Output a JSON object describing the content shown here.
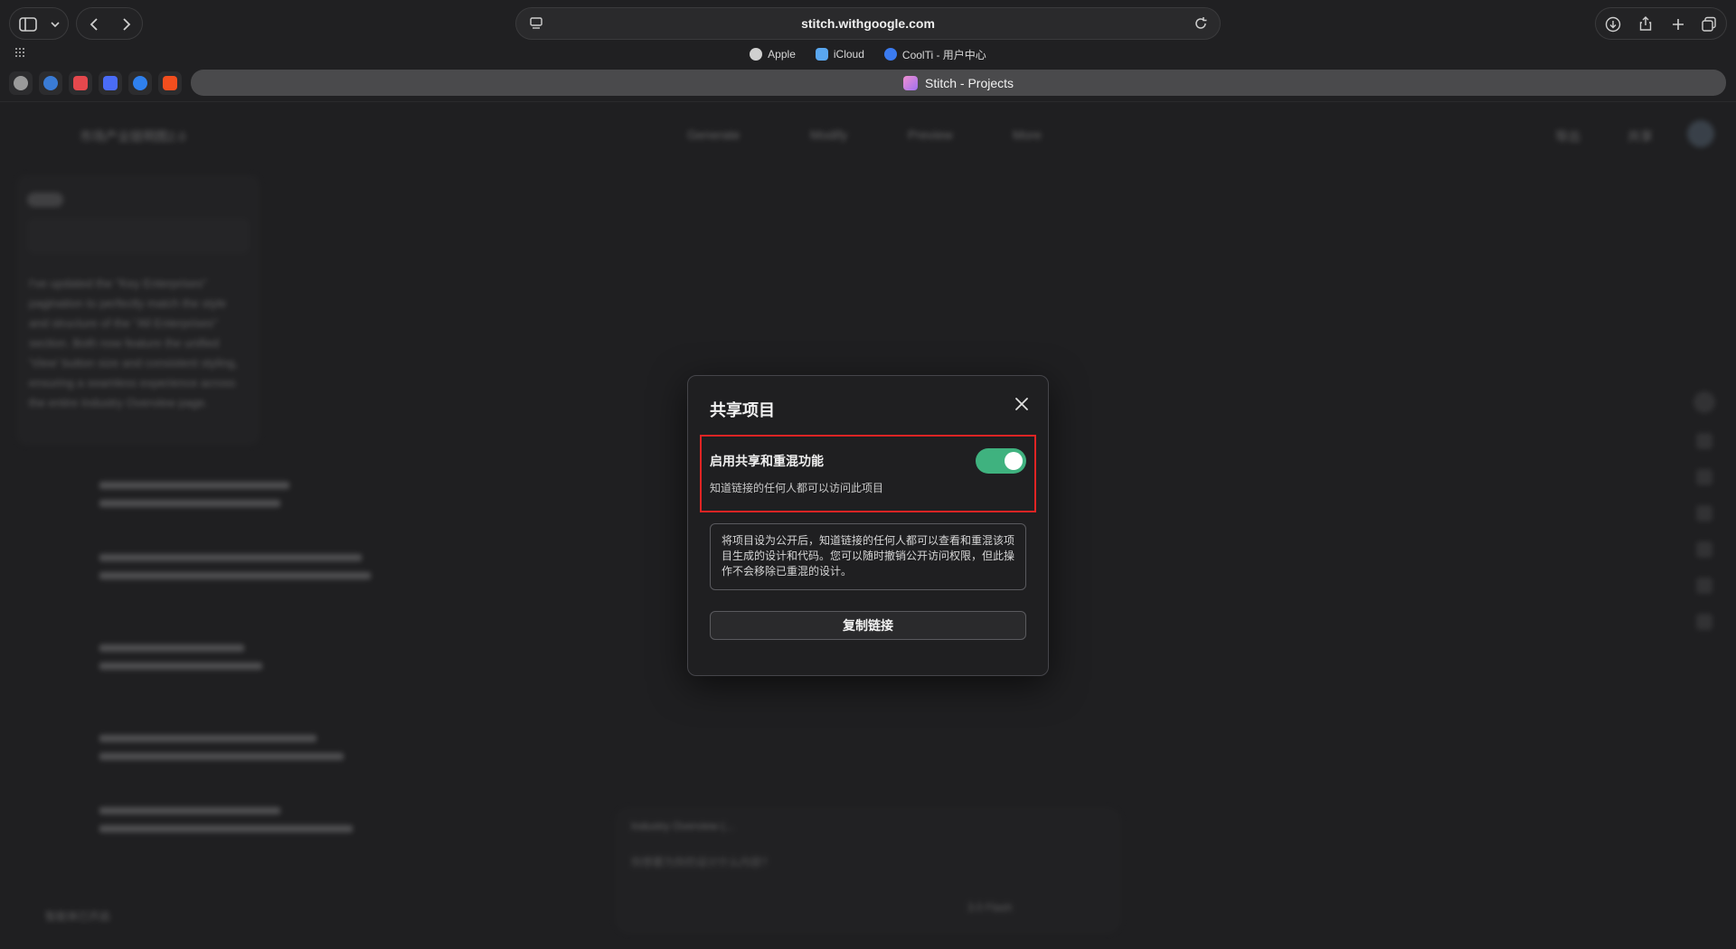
{
  "browser": {
    "url": "stitch.withgoogle.com",
    "tab_title": "Stitch - Projects",
    "bookmarks": [
      {
        "label": "Apple",
        "color": "#d0d0d0"
      },
      {
        "label": "iCloud",
        "color": "#5aa7f0"
      },
      {
        "label": "CoolTi - 用户中心",
        "color": "#3b7bf0"
      }
    ],
    "favicons": [
      "#9a9a9a",
      "#3a7bd5",
      "#e5484d",
      "#4a6cf7",
      "#2f80ed",
      "#f24e1e"
    ]
  },
  "app": {
    "project_title": "市场产业链明图2.0",
    "toolbar": [
      "Generate",
      "Modify",
      "Preview",
      "More"
    ],
    "header_actions": [
      "导出",
      "共享"
    ],
    "chat_text": "I've updated the \"Key Enterprises\" pagination to perfectly match the style and structure of the \"All Enterprises\" section. Both now feature the unified 'View' button size and consistent styling, ensuring a seamless experience across the entire Industry Overview page.",
    "prompt_chip": "Industry Overview (...",
    "prompt_placeholder": "你想要为你的设计什么内容?",
    "model_label": "3.0 Flash",
    "bottom_left": "智能体已开启"
  },
  "dialog": {
    "title": "共享项目",
    "share_toggle_label": "启用共享和重混功能",
    "share_toggle_desc": "知道链接的任何人都可以访问此项目",
    "share_enabled": true,
    "notice": "将项目设为公开后，知道链接的任何人都可以查看和重混该项目生成的设计和代码。您可以随时撤销公开访问权限，但此操作不会移除已重混的设计。",
    "copy_button": "复制链接",
    "accent_color": "#3fb27f",
    "highlight_color": "#e02424"
  }
}
